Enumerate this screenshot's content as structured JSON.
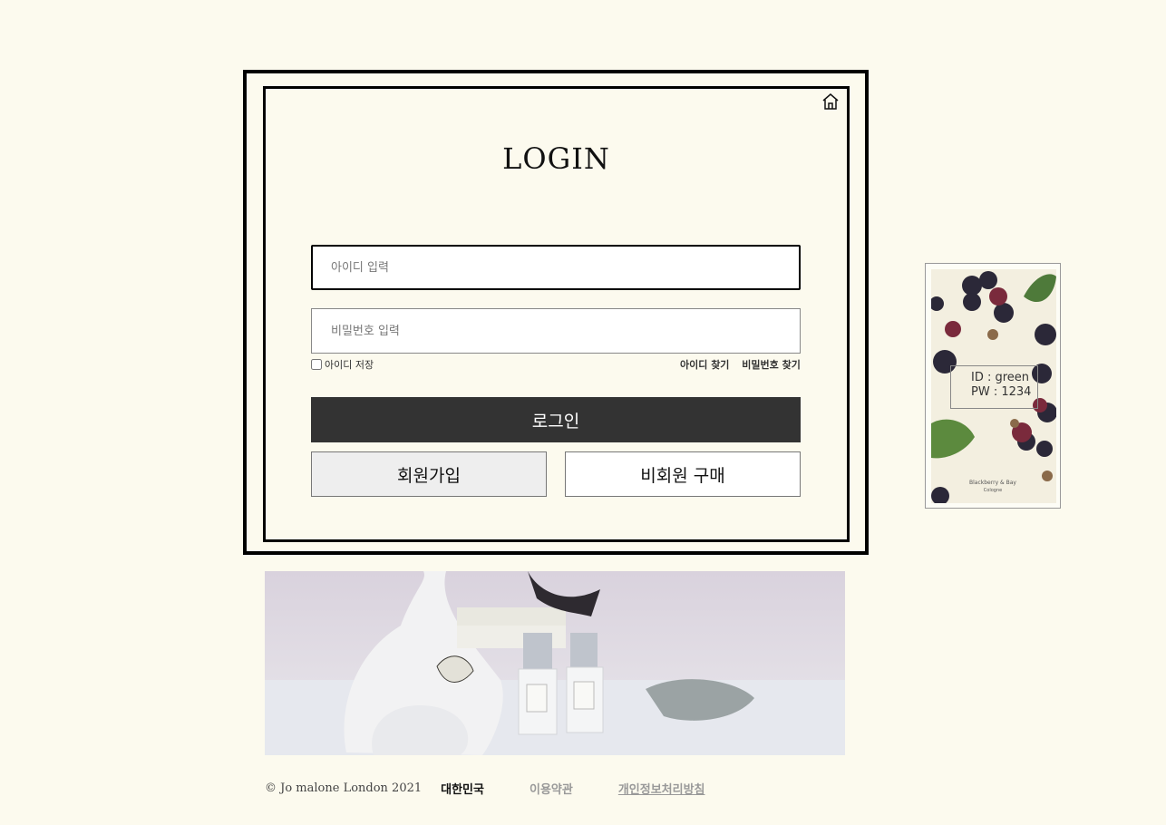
{
  "login": {
    "title": "LOGIN",
    "id_placeholder": "아이디 입력",
    "pw_placeholder": "비밀번호 입력",
    "save_id_label": "아이디 저장",
    "find_id": "아이디 찾기",
    "find_pw": "비밀번호 찾기",
    "login_button": "로그인",
    "signup_button": "회원가입",
    "guest_button": "비회원 구매"
  },
  "side_card": {
    "id_line": "ID : green",
    "pw_line": "PW : 1234",
    "caption_line1": "Blackberry & Bay",
    "caption_line2": "Cologne"
  },
  "footer": {
    "copyright": "© Jo malone London 2021",
    "country": "대한민국",
    "terms": "이용약관",
    "privacy": "개인정보처리방침"
  },
  "colors": {
    "background": "#fcfaee",
    "login_button": "#333333",
    "signup_button": "#eeeeee"
  }
}
